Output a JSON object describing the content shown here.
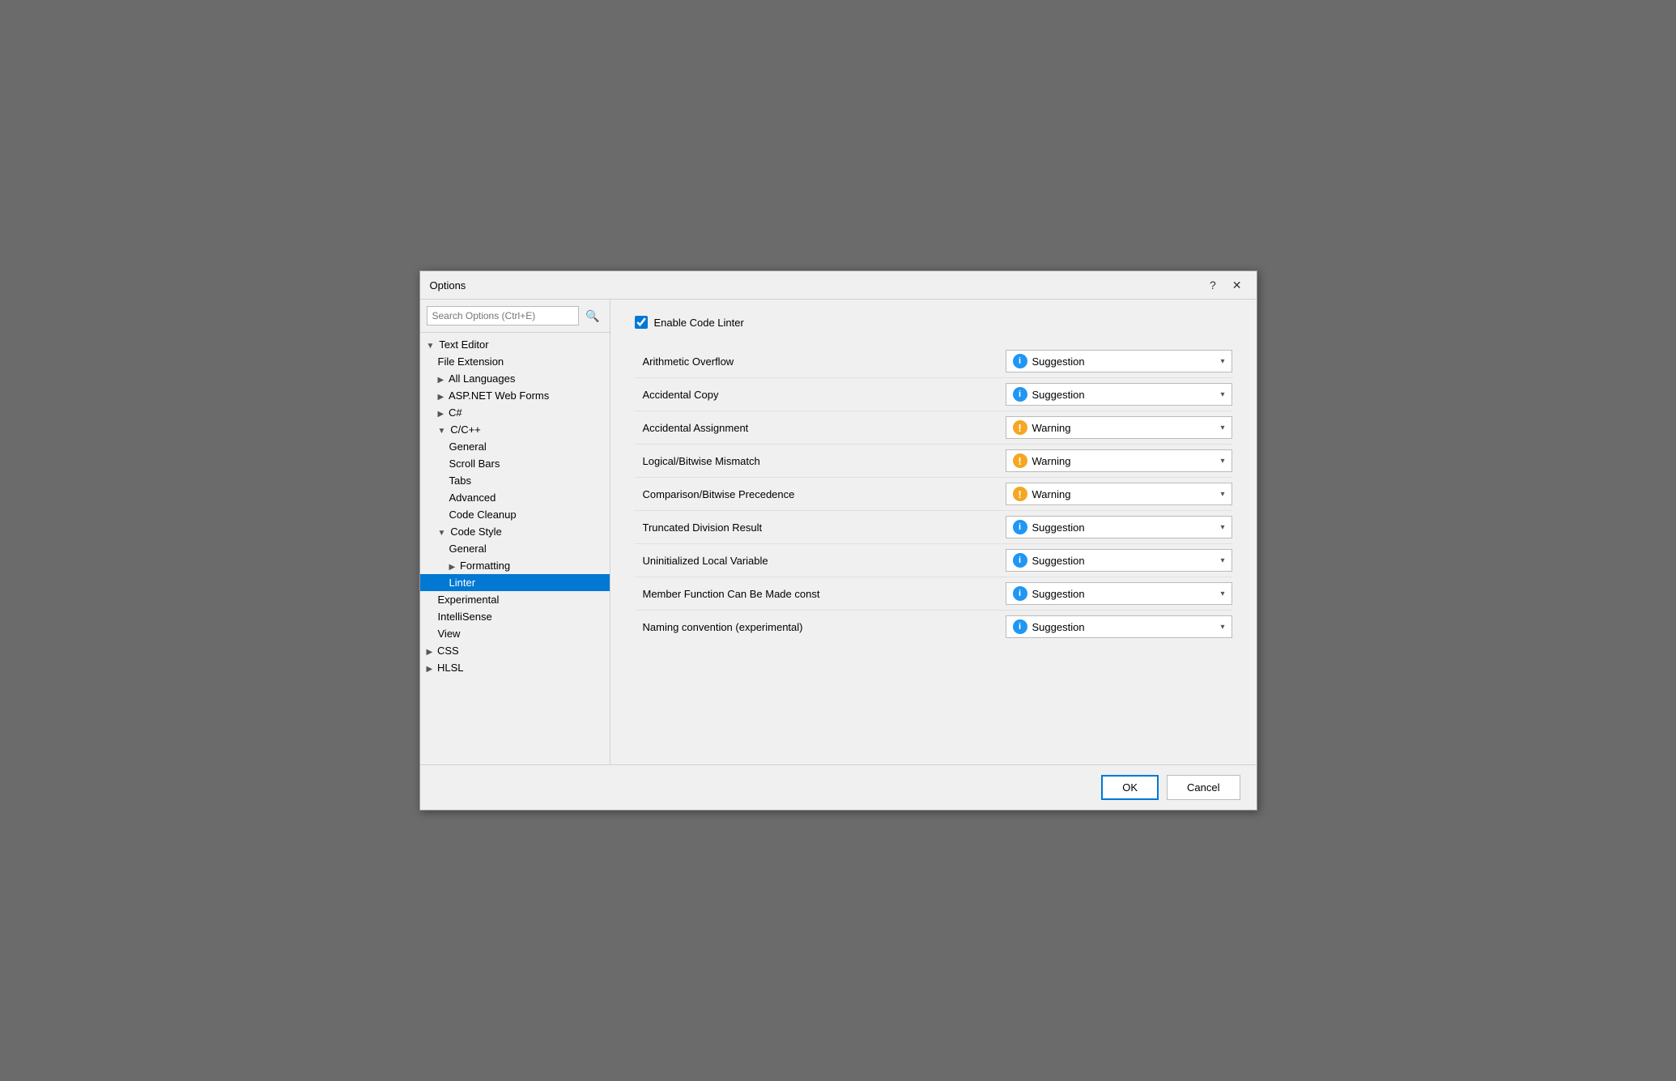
{
  "dialog": {
    "title": "Options"
  },
  "titleBar": {
    "helpButton": "?",
    "closeButton": "✕"
  },
  "search": {
    "placeholder": "Search Options (Ctrl+E)"
  },
  "tree": {
    "items": [
      {
        "id": "text-editor",
        "label": "Text Editor",
        "indent": 0,
        "prefix": "▼",
        "selected": false
      },
      {
        "id": "file-extension",
        "label": "File Extension",
        "indent": 1,
        "prefix": "",
        "selected": false
      },
      {
        "id": "all-languages",
        "label": "All Languages",
        "indent": 1,
        "prefix": "▶",
        "selected": false
      },
      {
        "id": "asp-net",
        "label": "ASP.NET Web Forms",
        "indent": 1,
        "prefix": "▶",
        "selected": false
      },
      {
        "id": "csharp",
        "label": "C#",
        "indent": 1,
        "prefix": "▶",
        "selected": false
      },
      {
        "id": "cpp",
        "label": "C/C++",
        "indent": 1,
        "prefix": "▼",
        "selected": false
      },
      {
        "id": "cpp-general",
        "label": "General",
        "indent": 2,
        "prefix": "",
        "selected": false
      },
      {
        "id": "cpp-scrollbars",
        "label": "Scroll Bars",
        "indent": 2,
        "prefix": "",
        "selected": false
      },
      {
        "id": "cpp-tabs",
        "label": "Tabs",
        "indent": 2,
        "prefix": "",
        "selected": false
      },
      {
        "id": "cpp-advanced",
        "label": "Advanced",
        "indent": 2,
        "prefix": "",
        "selected": false
      },
      {
        "id": "cpp-codecleanup",
        "label": "Code Cleanup",
        "indent": 2,
        "prefix": "",
        "selected": false
      },
      {
        "id": "code-style",
        "label": "Code Style",
        "indent": 1,
        "prefix": "▼",
        "selected": false
      },
      {
        "id": "cs-general",
        "label": "General",
        "indent": 2,
        "prefix": "",
        "selected": false
      },
      {
        "id": "cs-formatting",
        "label": "Formatting",
        "indent": 2,
        "prefix": "▶",
        "selected": false
      },
      {
        "id": "cs-linter",
        "label": "Linter",
        "indent": 2,
        "prefix": "",
        "selected": true
      },
      {
        "id": "cs-experimental",
        "label": "Experimental",
        "indent": 1,
        "prefix": "",
        "selected": false
      },
      {
        "id": "cs-intellisense",
        "label": "IntelliSense",
        "indent": 1,
        "prefix": "",
        "selected": false
      },
      {
        "id": "cs-view",
        "label": "View",
        "indent": 1,
        "prefix": "",
        "selected": false
      },
      {
        "id": "css",
        "label": "CSS",
        "indent": 0,
        "prefix": "▶",
        "selected": false
      },
      {
        "id": "hlsl",
        "label": "HLSL",
        "indent": 0,
        "prefix": "▶",
        "selected": false
      }
    ]
  },
  "linter": {
    "enableLabel": "Enable Code Linter",
    "enableChecked": true,
    "rows": [
      {
        "id": "arithmetic-overflow",
        "label": "Arithmetic Overflow",
        "value": "Suggestion",
        "type": "info"
      },
      {
        "id": "accidental-copy",
        "label": "Accidental Copy",
        "value": "Suggestion",
        "type": "info"
      },
      {
        "id": "accidental-assignment",
        "label": "Accidental Assignment",
        "value": "Warning",
        "type": "warning"
      },
      {
        "id": "logical-bitwise-mismatch",
        "label": "Logical/Bitwise Mismatch",
        "value": "Warning",
        "type": "warning"
      },
      {
        "id": "comparison-bitwise-precedence",
        "label": "Comparison/Bitwise Precedence",
        "value": "Warning",
        "type": "warning"
      },
      {
        "id": "truncated-division-result",
        "label": "Truncated Division Result",
        "value": "Suggestion",
        "type": "info"
      },
      {
        "id": "uninitialized-local-variable",
        "label": "Uninitialized Local Variable",
        "value": "Suggestion",
        "type": "info"
      },
      {
        "id": "member-function-const",
        "label": "Member Function Can Be Made const",
        "value": "Suggestion",
        "type": "info"
      },
      {
        "id": "naming-convention",
        "label": "Naming convention (experimental)",
        "value": "Suggestion",
        "type": "info"
      }
    ]
  },
  "footer": {
    "okLabel": "OK",
    "cancelLabel": "Cancel"
  }
}
